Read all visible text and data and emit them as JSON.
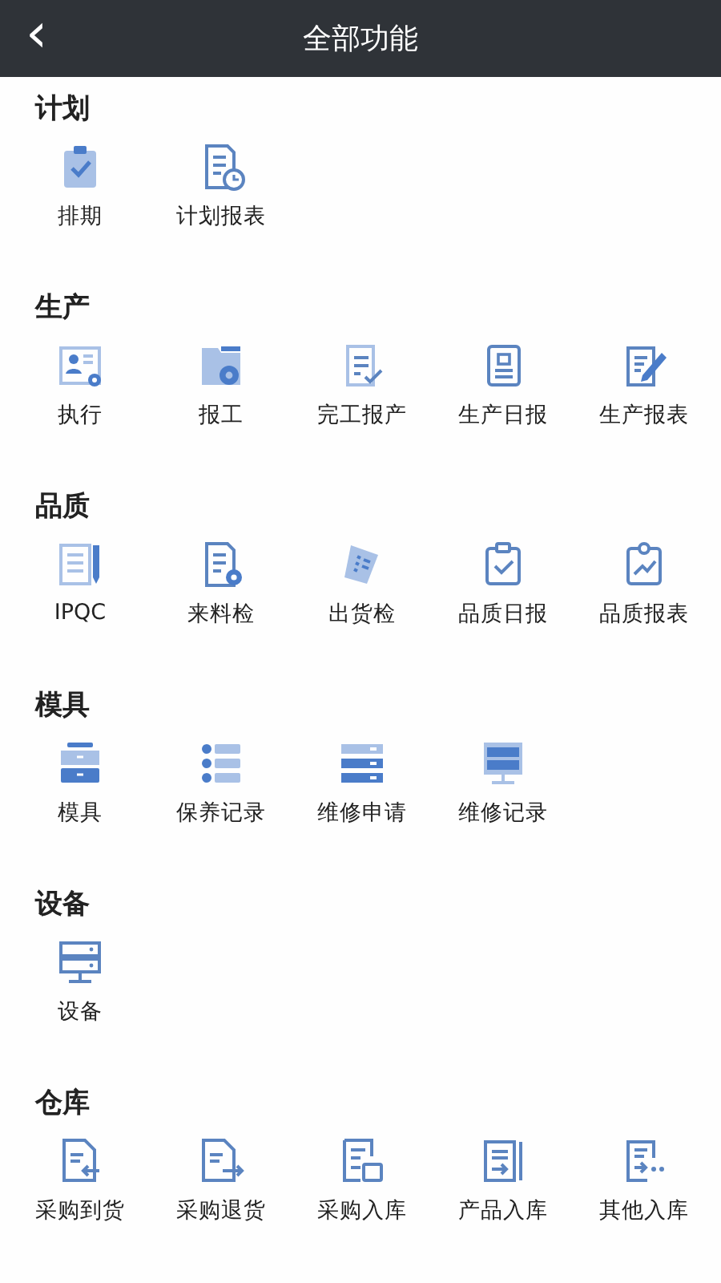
{
  "header": {
    "back": "‹",
    "title": "全部功能"
  },
  "sections": [
    {
      "title": "计划",
      "items": [
        "排期",
        "计划报表"
      ]
    },
    {
      "title": "生产",
      "items": [
        "执行",
        "报工",
        "完工报产",
        "生产日报",
        "生产报表"
      ]
    },
    {
      "title": "品质",
      "items": [
        "IPQC",
        "来料检",
        "出货检",
        "品质日报",
        "品质报表"
      ]
    },
    {
      "title": "模具",
      "items": [
        "模具",
        "保养记录",
        "维修申请",
        "维修记录"
      ]
    },
    {
      "title": "设备",
      "items": [
        "设备"
      ]
    },
    {
      "title": "仓库",
      "items": [
        "采购到货",
        "采购退货",
        "采购入库",
        "产品入库",
        "其他入库"
      ]
    }
  ]
}
